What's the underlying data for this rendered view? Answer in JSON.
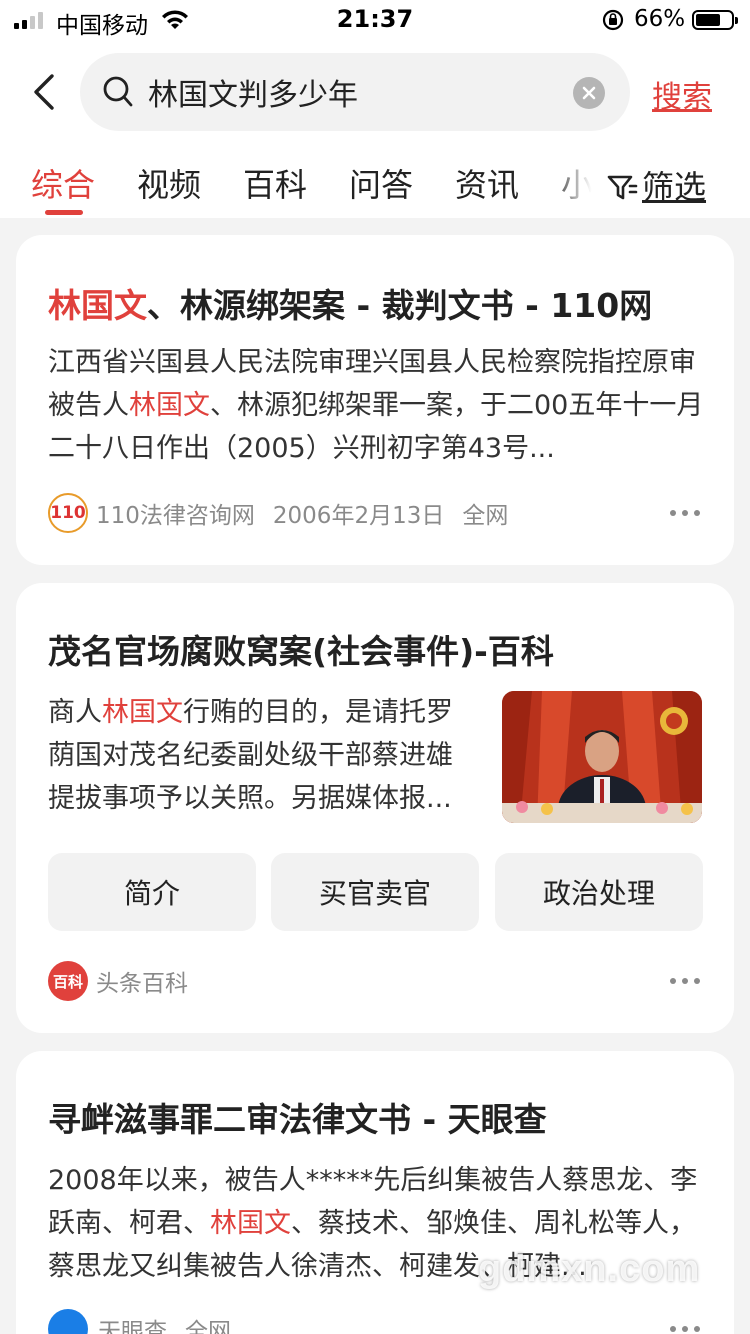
{
  "status_bar": {
    "carrier": "中国移动",
    "time": "21:37",
    "battery": "66%",
    "battery_level": 0.66,
    "icons": [
      "signal-icon",
      "wifi-icon",
      "rotation-lock-icon",
      "battery-icon"
    ]
  },
  "search": {
    "query": "林国文判多少年",
    "button": "搜索"
  },
  "tabs": {
    "items": [
      "综合",
      "视频",
      "百科",
      "问答",
      "资讯",
      "小"
    ],
    "active": "综合",
    "filter": "筛选"
  },
  "results": [
    {
      "title_hl": "林国文",
      "title_rest": "、林源绑架案 - 裁判文书 - 110网",
      "snippet_1": "江西省兴国县人民法院审理兴国县人民检察院指控原审被告人",
      "snippet_hl": "林国文",
      "snippet_2": "、林源犯绑架罪一案，于二00五年十一月二十八日作出（2005）兴刑初字第43号...",
      "logo_text": "110",
      "source": "110法律咨询网",
      "date": "2006年2月13日",
      "scope": "全网"
    },
    {
      "title": "茂名官场腐败窝案(社会事件)-百科",
      "snippet_1": "商人",
      "snippet_hl": "林国文",
      "snippet_2": "行贿的目的，是请托罗荫国对茂名纪委副处级干部蔡进雄提拔事项予以关照。另据媒体报...",
      "chips": [
        "简介",
        "买官卖官",
        "政治处理"
      ],
      "logo_text": "百科",
      "source": "头条百科"
    },
    {
      "title": "寻衅滋事罪二审法律文书 - 天眼查",
      "snippet_1": "2008年以来，被告人*****先后纠集被告人蔡思龙、李跃南、柯君、",
      "snippet_hl": "林国文",
      "snippet_2": "、蔡技术、邹焕佳、周礼松等人，蔡思龙又纠集被告人徐清杰、柯建发、柯建...",
      "source": "天眼查",
      "scope": "全网"
    }
  ],
  "watermark": "gdmxn.com",
  "colors": {
    "accent": "#e0413c",
    "background": "#f3f3f3",
    "card": "#ffffff"
  }
}
